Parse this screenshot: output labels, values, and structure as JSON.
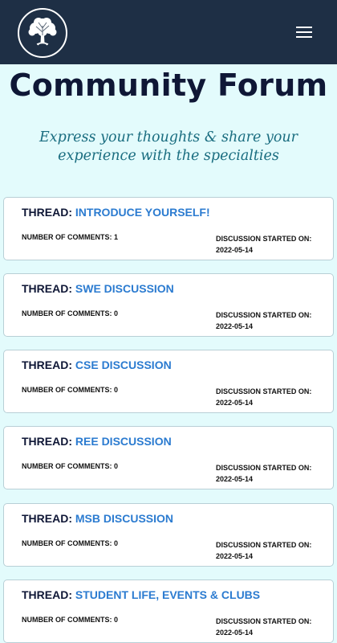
{
  "header": {
    "logo_icon": "tree-logo-icon",
    "menu_icon": "hamburger-menu-icon",
    "background_color": "#1e2f45"
  },
  "hero": {
    "title": "Community Forum",
    "subtitle": "Express your thoughts & share your experience with the specialties"
  },
  "thread_prefix": "THREAD: ",
  "comments_label": "NUMBER OF COMMENTS: ",
  "started_label": "DISCUSSION STARTED ON:",
  "threads": [
    {
      "name": "INTRODUCE YOURSELF!",
      "comments": "1",
      "started": "2022-05-14"
    },
    {
      "name": "SWE DISCUSSION",
      "comments": "0",
      "started": "2022-05-14"
    },
    {
      "name": "CSE DISCUSSION",
      "comments": "0",
      "started": "2022-05-14"
    },
    {
      "name": "REE DISCUSSION",
      "comments": "0",
      "started": "2022-05-14"
    },
    {
      "name": "MSB DISCUSSION",
      "comments": "0",
      "started": "2022-05-14"
    },
    {
      "name": "STUDENT LIFE, EVENTS & CLUBS",
      "comments": "0",
      "started": "2022-05-14"
    }
  ]
}
